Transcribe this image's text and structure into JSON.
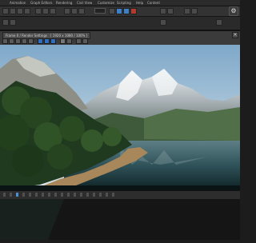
{
  "menubar": {
    "items": [
      "Animation",
      "Graph Editors",
      "Rendering",
      "Civil View",
      "Customize",
      "Scripting",
      "Help",
      "Content"
    ]
  },
  "viewport": {
    "title": "Frame 0 / Render Settings : [ 1920 x 1080 / 100% ]",
    "close_glyph": "×"
  },
  "icons": {
    "toolbar": [
      "select-icon",
      "move-icon",
      "rotate-icon",
      "scale-icon",
      "snap-icon",
      "render-setup-icon",
      "render-frame-icon",
      "render-icon"
    ],
    "viewport_header": [
      "save-image-icon",
      "copy-image-icon",
      "clone-window-icon",
      "print-icon",
      "clear-icon",
      "red-channel-icon",
      "green-channel-icon",
      "blue-channel-icon",
      "alpha-icon",
      "mono-icon"
    ]
  },
  "colors": {
    "accent_blue": "#3f7fc8",
    "render_red": "#b23a2f"
  }
}
